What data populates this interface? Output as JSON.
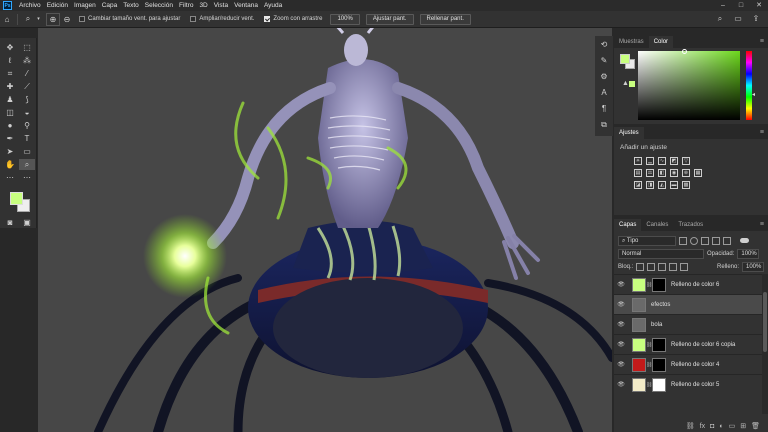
{
  "app": {
    "logo": "Ps"
  },
  "menu": [
    "Archivo",
    "Edición",
    "Imagen",
    "Capa",
    "Texto",
    "Selección",
    "Filtro",
    "3D",
    "Vista",
    "Ventana",
    "Ayuda"
  ],
  "window": {
    "minimize": "–",
    "maximize": "□",
    "close": "✕"
  },
  "options": {
    "resize_windows_label": "Cambiar tamaño vent. para ajustar",
    "zoom_all_label": "Ampliar/reducir vent.",
    "scrubby_zoom_label": "Zoom con arrastre",
    "zoom_value": "100%",
    "fit_button": "Ajustar pant.",
    "fill_button": "Rellenar pant."
  },
  "color_panel": {
    "tabs": [
      "Muestras",
      "Color"
    ],
    "active_tab": "Color",
    "foreground": "#c8ff80",
    "background": "#eaeaea"
  },
  "adjustments": {
    "tab": "Ajustes",
    "subtitle": "Añadir un ajuste"
  },
  "layers": {
    "tabs": [
      "Capas",
      "Canales",
      "Trazados"
    ],
    "filter_kind": "Tipo",
    "blend_mode": "Normal",
    "opacity_label": "Opacidad:",
    "opacity": "100%",
    "lock_label": "Bloq.:",
    "fill_label": "Relleno:",
    "fill": "100%",
    "items": [
      {
        "name": "Relleno de color 6",
        "thumb": "#c8ff80",
        "mask": true,
        "selected": false
      },
      {
        "name": "efectos",
        "thumb": "#6a6a6a",
        "mask": false,
        "selected": true
      },
      {
        "name": "bola",
        "thumb": "#6a6a6a",
        "mask": false,
        "selected": false
      },
      {
        "name": "Relleno de color 6 copia",
        "thumb": "#c8ff80",
        "mask": true,
        "selected": false
      },
      {
        "name": "Relleno de color 4",
        "thumb": "#c41a1a",
        "mask": true,
        "selected": false
      },
      {
        "name": "Relleno de color 5",
        "thumb": "#f3ecc8",
        "mask": true,
        "selected": false
      }
    ]
  }
}
